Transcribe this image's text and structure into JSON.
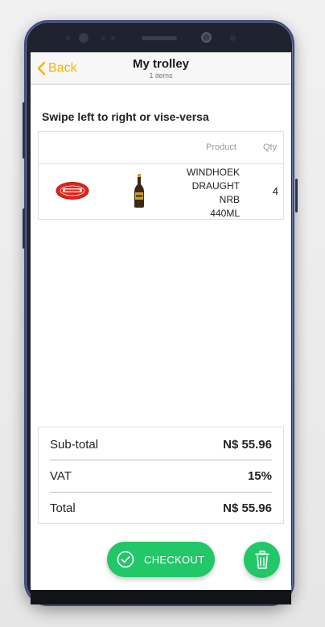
{
  "header": {
    "back_label": "Back",
    "title": "My trolley",
    "subtitle": "1 items"
  },
  "hint": "Swipe left to right or vise-versa",
  "table": {
    "columns": {
      "product": "Product",
      "qty": "Qty"
    },
    "rows": [
      {
        "store_logo": "metro-logo",
        "product_image": "beer-bottle",
        "name_lines": [
          "WINDHOEK",
          "DRAUGHT",
          "NRB",
          "440ML"
        ],
        "qty": "4"
      }
    ]
  },
  "totals": {
    "subtotal_label": "Sub-total",
    "subtotal_value": "N$ 55.96",
    "vat_label": "VAT",
    "vat_value": "15%",
    "total_label": "Total",
    "total_value": "N$ 55.96"
  },
  "actions": {
    "checkout_label": "CHECKOUT",
    "checkout_icon": "check-circle-icon",
    "delete_icon": "trash-icon"
  },
  "colors": {
    "accent": "#f5b400",
    "primary_green": "#22c768"
  }
}
